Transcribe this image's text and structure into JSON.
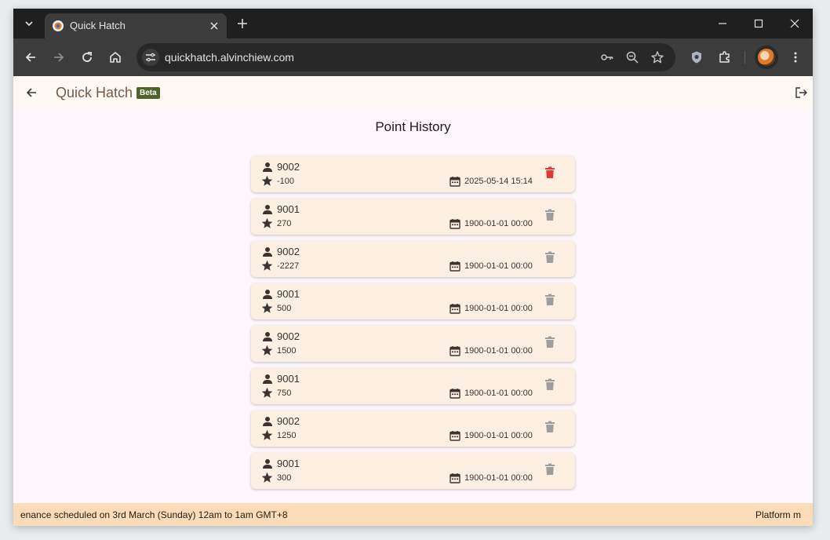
{
  "browser": {
    "tab": {
      "title": "Quick Hatch"
    },
    "url": "quickhatch.alvinchiew.com"
  },
  "app": {
    "title": "Quick Hatch",
    "badge": "Beta",
    "page_title": "Point History"
  },
  "history": [
    {
      "user": "9002",
      "points": "-100",
      "date": "2025-05-14 15:14",
      "delete_active": true
    },
    {
      "user": "9001",
      "points": "270",
      "date": "1900-01-01 00:00",
      "delete_active": false
    },
    {
      "user": "9002",
      "points": "-2227",
      "date": "1900-01-01 00:00",
      "delete_active": false
    },
    {
      "user": "9001",
      "points": "500",
      "date": "1900-01-01 00:00",
      "delete_active": false
    },
    {
      "user": "9002",
      "points": "1500",
      "date": "1900-01-01 00:00",
      "delete_active": false
    },
    {
      "user": "9001",
      "points": "750",
      "date": "1900-01-01 00:00",
      "delete_active": false
    },
    {
      "user": "9002",
      "points": "1250",
      "date": "1900-01-01 00:00",
      "delete_active": false
    },
    {
      "user": "9001",
      "points": "300",
      "date": "1900-01-01 00:00",
      "delete_active": false
    }
  ],
  "banner": {
    "text": "enance scheduled on 3rd March (Sunday) 12am to 1am GMT+8",
    "text2": "Platform m"
  },
  "colors": {
    "delete_active": "#e53935",
    "delete_inactive": "#9e9e9e",
    "card_bg": "#fdefe2",
    "banner_bg": "#fcdcb8",
    "beta_bg": "#4f6229"
  }
}
